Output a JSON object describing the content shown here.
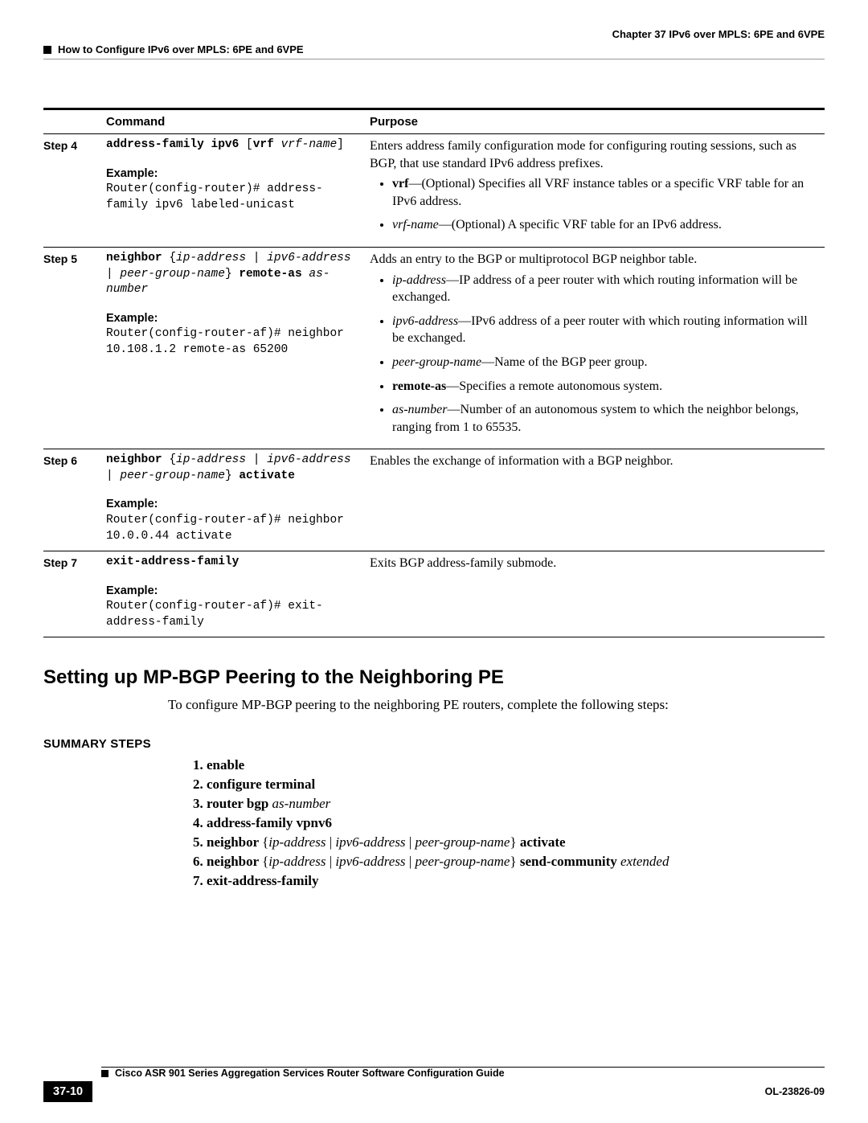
{
  "header": {
    "chapter": "Chapter 37    IPv6 over MPLS: 6PE and 6VPE",
    "breadcrumb": "How to Configure IPv6 over MPLS: 6PE and 6VPE"
  },
  "table": {
    "headers": {
      "c1": "",
      "c2": "Command",
      "c3": "Purpose"
    },
    "rows": [
      {
        "step": "Step 4",
        "cmd_b1": "address-family ipv6",
        "cmd_m1": " [",
        "cmd_b2": "vrf",
        "cmd_m2": " ",
        "cmd_i1": "vrf-name",
        "cmd_m3": "]",
        "example_label": "Example:",
        "example": "Router(config-router)# address-family ipv6 labeled-unicast",
        "purpose_intro": "Enters address family configuration mode for configuring routing sessions, such as BGP, that use standard IPv6 address prefixes.",
        "bullets": [
          {
            "b": "vrf",
            "t": "—(Optional) Specifies all VRF instance tables or a specific VRF table for an IPv6 address."
          },
          {
            "i": "vrf-name",
            "t": "—(Optional) A specific VRF table for an IPv6 address."
          }
        ]
      },
      {
        "step": "Step 5",
        "cmd_b1": "neighbor",
        "cmd_m1": " {",
        "cmd_i1": "ip-address",
        "cmd_m2": " | ",
        "cmd_i2": "ipv6-address",
        "cmd_m3": " | ",
        "cmd_i3": "peer-group-name",
        "cmd_m4": "} ",
        "cmd_b2": "remote-as",
        "cmd_m5": " ",
        "cmd_i4": "as-number",
        "example_label": "Example:",
        "example": "Router(config-router-af)# neighbor 10.108.1.2 remote-as 65200",
        "purpose_intro": "Adds an entry to the BGP or multiprotocol BGP neighbor table.",
        "bullets": [
          {
            "i": "ip-address",
            "t": "—IP address of a peer router with which routing information will be exchanged."
          },
          {
            "i": "ipv6-address",
            "t": "—IPv6 address of a peer router with which routing information will be exchanged."
          },
          {
            "i": "peer-group-name",
            "t": "—Name of the BGP peer group."
          },
          {
            "b": "remote-as",
            "t": "—Specifies a remote autonomous system."
          },
          {
            "i": "as-number",
            "t": "—Number of an autonomous system to which the neighbor belongs, ranging from 1 to 65535."
          }
        ]
      },
      {
        "step": "Step 6",
        "cmd_b1": "neighbor",
        "cmd_m1": " {",
        "cmd_i1": "ip-address",
        "cmd_m2": " | ",
        "cmd_i2": "ipv6-address",
        "cmd_m3": " | ",
        "cmd_i3": "peer-group-name",
        "cmd_m4": "} ",
        "cmd_b2": "activate",
        "example_label": "Example:",
        "example": "Router(config-router-af)# neighbor 10.0.0.44 activate",
        "purpose_intro": "Enables the exchange of information with a BGP neighbor."
      },
      {
        "step": "Step 7",
        "cmd_b1": "exit-address-family",
        "example_label": "Example:",
        "example": "Router(config-router-af)# exit-address-family",
        "purpose_intro": "Exits BGP address-family submode."
      }
    ]
  },
  "section": {
    "title": "Setting up MP-BGP Peering to the Neighboring PE",
    "intro": "To configure MP-BGP peering to the neighboring PE routers, complete the following steps:",
    "summary_label": "SUMMARY STEPS",
    "steps": {
      "s1": "enable",
      "s2": "configure terminal",
      "s3_a": "router bgp ",
      "s3_b": "as-number",
      "s4": "address-family vpnv6",
      "s5_a": "neighbor ",
      "s5_b": "{",
      "s5_c": "ip-address",
      "s5_d": " | ",
      "s5_e": "ipv6-address",
      "s5_f": " | ",
      "s5_g": "peer-group-name",
      "s5_h": "} ",
      "s5_i": "activate",
      "s6_a": "neighbor ",
      "s6_b": "{",
      "s6_c": "ip-address",
      "s6_d": " | ",
      "s6_e": "ipv6-address",
      "s6_f": " | ",
      "s6_g": "peer-group-name",
      "s6_h": "} ",
      "s6_i": "send-community ",
      "s6_j": "extended",
      "s7": "exit-address-family"
    }
  },
  "footer": {
    "guide": "Cisco ASR 901 Series Aggregation Services Router Software Configuration Guide",
    "page": "37-10",
    "docid": "OL-23826-09"
  }
}
